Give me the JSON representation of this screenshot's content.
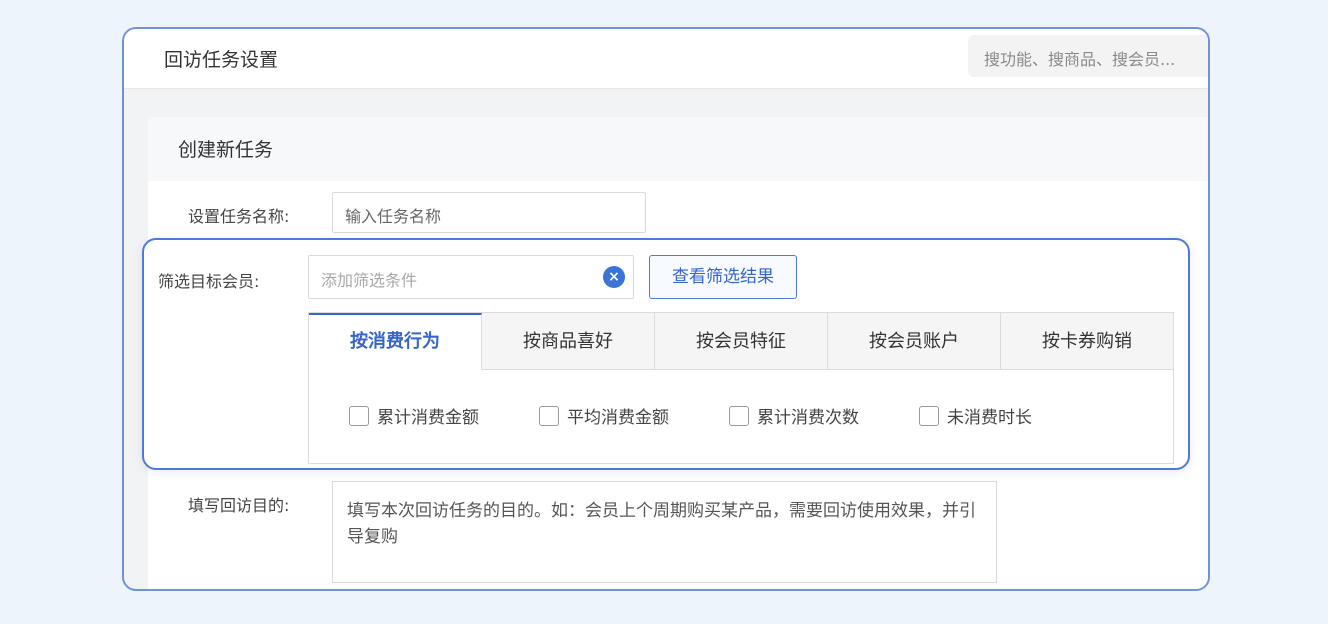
{
  "window": {
    "title": "回访任务设置",
    "search_placeholder": "搜功能、搜商品、搜会员..."
  },
  "panel": {
    "title": "创建新任务"
  },
  "task_name": {
    "label": "设置任务名称:",
    "placeholder": "输入任务名称"
  },
  "filter": {
    "label": "筛选目标会员:",
    "placeholder": "添加筛选条件",
    "clear_icon": "×",
    "result_button": "查看筛选结果",
    "tabs": [
      {
        "label": "按消费行为",
        "active": true
      },
      {
        "label": "按商品喜好",
        "active": false
      },
      {
        "label": "按会员特征",
        "active": false
      },
      {
        "label": "按会员账户",
        "active": false
      },
      {
        "label": "按卡券购销",
        "active": false
      }
    ],
    "checkboxes": [
      {
        "label": "累计消费金额",
        "checked": false
      },
      {
        "label": "平均消费金额",
        "checked": false
      },
      {
        "label": "累计消费次数",
        "checked": false
      },
      {
        "label": "未消费时长",
        "checked": false
      }
    ]
  },
  "purpose": {
    "label": "填写回访目的:",
    "placeholder": "填写本次回访任务的目的。如：会员上个周期购买某产品，需要回访使用效果，并引导复购"
  },
  "colors": {
    "accent": "#3565c9",
    "highlight_border": "#4f7bd6",
    "background": "#eef4fb"
  }
}
